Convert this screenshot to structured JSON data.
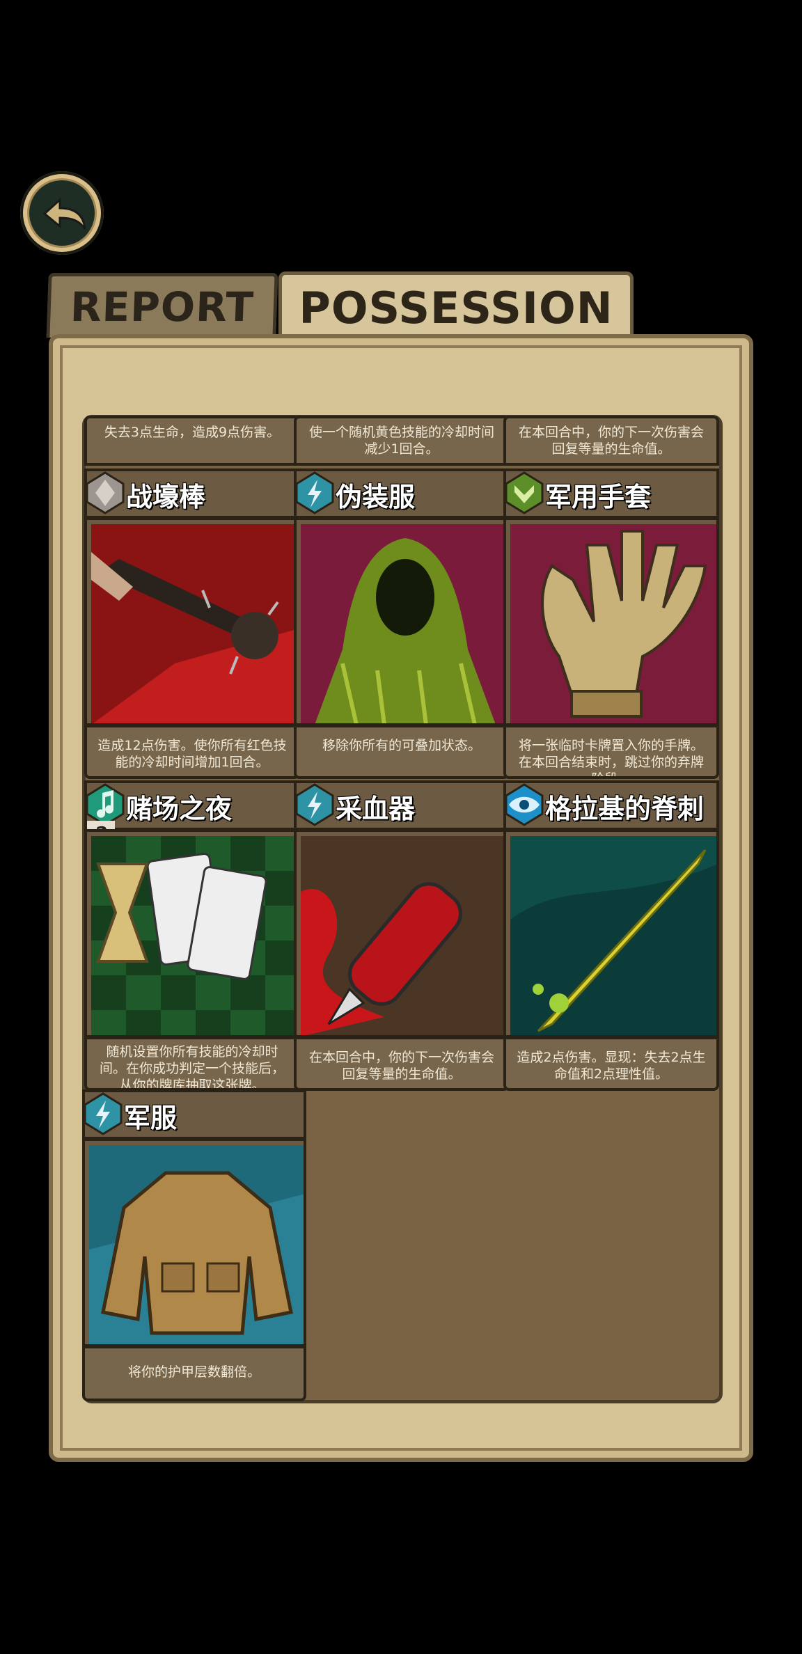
{
  "tabs": [
    {
      "label": "REPORT",
      "active": false
    },
    {
      "label": "POSSESSION",
      "active": true
    }
  ],
  "top_descriptions": [
    "失去3点生命，造成9点伤害。",
    "使一个随机黄色技能的冷却时间减少1回合。",
    "在本回合中，你的下一次伤害会回复等量的生命值。"
  ],
  "cards": [
    {
      "name": "战壕棒",
      "gem_color": "#9c9590",
      "gem_icon": "diamond-icon",
      "art": "trench-club",
      "description": "造成12点伤害。使你所有红色技能的冷却时间增加1回合。"
    },
    {
      "name": "伪装服",
      "gem_color": "#2f93a6",
      "gem_icon": "lightning-icon",
      "art": "ghillie-suit",
      "description": "移除你所有的可叠加状态。"
    },
    {
      "name": "军用手套",
      "gem_color": "#5c8f2a",
      "gem_icon": "chevron-icon",
      "art": "military-glove",
      "description": "将一张临时卡牌置入你的手牌。在本回合结束时，跳过你的弃牌阶段。"
    },
    {
      "name": "赌场之夜",
      "gem_color": "#1f9a7a",
      "gem_icon": "music-note-icon",
      "art": "casino-night",
      "description": "随机设置你所有技能的冷却时间。在你成功判定一个技能后，从你的牌库抽取这张牌。",
      "badge": "2"
    },
    {
      "name": "采血器",
      "gem_color": "#2f93a6",
      "gem_icon": "lightning-icon",
      "art": "blood-syringe",
      "description": "在本回合中，你的下一次伤害会回复等量的生命值。"
    },
    {
      "name": "格拉基的脊刺",
      "gem_color": "#1d8fc9",
      "gem_icon": "eye-icon",
      "art": "glaaki-spine",
      "description": "造成2点伤害。显现：失去2点生命值和2点理性值。"
    },
    {
      "name": "军服",
      "gem_color": "#2f93a6",
      "gem_icon": "lightning-icon",
      "art": "military-uniform",
      "description": "将你的护甲层数翻倍。"
    }
  ],
  "colors": {
    "panel": "#d5c396",
    "inner": "#7a6344",
    "card": "#6c5a43"
  }
}
